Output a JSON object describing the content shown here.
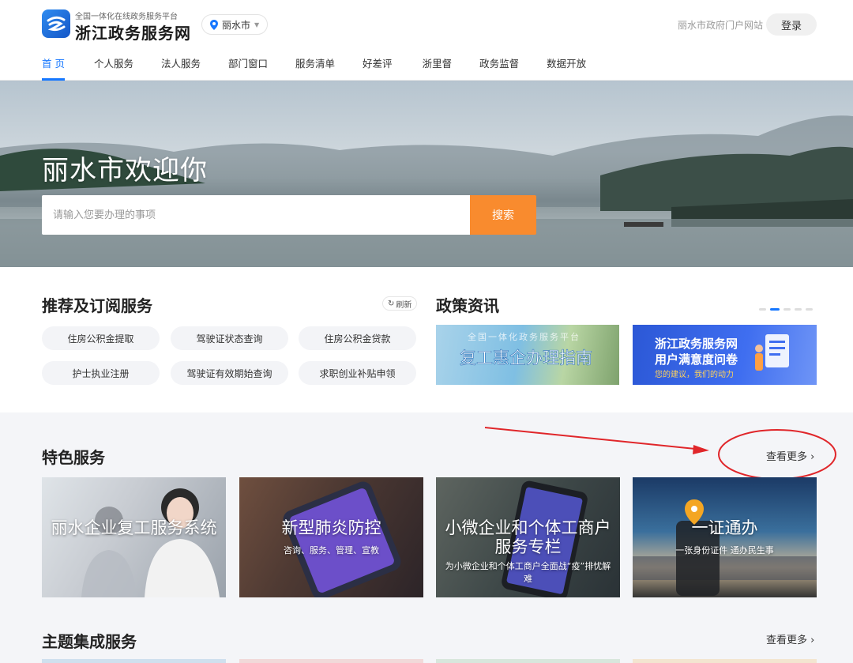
{
  "header": {
    "logo_subtitle": "全国一体化在线政务服务平台",
    "logo_title": "浙江政务服务网",
    "city": "丽水市",
    "portal_link": "丽水市政府门户网站",
    "login": "登录"
  },
  "nav": [
    "首 页",
    "个人服务",
    "法人服务",
    "部门窗口",
    "服务清单",
    "好差评",
    "浙里督",
    "政务监督",
    "数据开放"
  ],
  "banner": {
    "title": "丽水市欢迎你",
    "search_placeholder": "请输入您要办理的事项",
    "search_button": "搜索"
  },
  "recommend": {
    "title": "推荐及订阅服务",
    "refresh": "刷新",
    "items": [
      "住房公积金提取",
      "驾驶证状态查询",
      "住房公积金贷款",
      "护士执业注册",
      "驾驶证有效期始查询",
      "求职创业补贴申领"
    ]
  },
  "policy": {
    "title": "政策资讯",
    "news1_top": "全国一体化政务服务平台",
    "news1_main": "复工惠企办理指南",
    "news2_line1": "浙江政务服务网",
    "news2_line2": "用户满意度问卷",
    "news2_line3": "您的建议，我们的动力"
  },
  "featured": {
    "title": "特色服务",
    "more": "查看更多",
    "cards": [
      {
        "title": "丽水企业复工服务系统",
        "subtitle": ""
      },
      {
        "title": "新型肺炎防控",
        "subtitle": "咨询、服务、管理、宣教"
      },
      {
        "title": "小微企业和个体工商户服务专栏",
        "subtitle": "为小微企业和个体工商户全面战“疫”排忧解难"
      },
      {
        "title": "一证通办",
        "subtitle": "一张身份证件 通办民生事"
      }
    ]
  },
  "theme": {
    "title": "主题集成服务",
    "more": "查看更多"
  },
  "colors": {
    "brand_blue": "#1677ff",
    "search_orange": "#f98b2e",
    "annotation_red": "#e0262a"
  }
}
